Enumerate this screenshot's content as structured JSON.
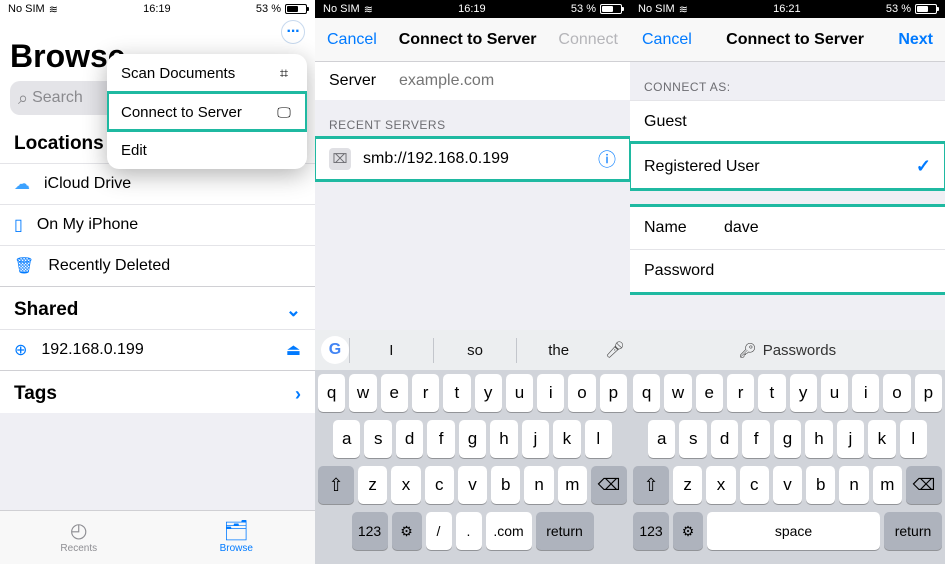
{
  "status": {
    "carrier": "No SIM",
    "wifi": true,
    "time1": "16:19",
    "time2": "16:19",
    "time3": "16:21",
    "battery": "53 %"
  },
  "p1": {
    "title": "Browse",
    "search_placeholder": "Search",
    "menu": {
      "scan": "Scan Documents",
      "connect": "Connect to Server",
      "edit": "Edit"
    },
    "sections": {
      "locations": "Locations",
      "shared": "Shared",
      "tags": "Tags"
    },
    "rows": {
      "icloud": "iCloud Drive",
      "onphone": "On My iPhone",
      "deleted": "Recently Deleted",
      "shared_server": "192.168.0.199"
    },
    "tabs": {
      "recents": "Recents",
      "browse": "Browse"
    }
  },
  "p2": {
    "cancel": "Cancel",
    "title": "Connect to Server",
    "connect": "Connect",
    "server_label": "Server",
    "server_placeholder": "example.com",
    "server_value": "smb://192.168.0.199",
    "recent_label": "RECENT SERVERS",
    "recent_server": "smb://192.168.0.199",
    "suggestions": [
      "I",
      "so",
      "the"
    ]
  },
  "p3": {
    "cancel": "Cancel",
    "title": "Connect to Server",
    "next": "Next",
    "connect_as": "CONNECT AS:",
    "guest": "Guest",
    "registered": "Registered User",
    "name_label": "Name",
    "name_value": "dave",
    "password_label": "Password",
    "password_suggestion": "Passwords"
  },
  "kbd": {
    "row1": [
      "q",
      "w",
      "e",
      "r",
      "t",
      "y",
      "u",
      "i",
      "o",
      "p"
    ],
    "row2": [
      "a",
      "s",
      "d",
      "f",
      "g",
      "h",
      "j",
      "k",
      "l"
    ],
    "row3": [
      "z",
      "x",
      "c",
      "v",
      "b",
      "n",
      "m"
    ],
    "num": "123",
    "slash": "/",
    "dot": ".",
    "com": ".com",
    "return": "return",
    "space": "space"
  }
}
